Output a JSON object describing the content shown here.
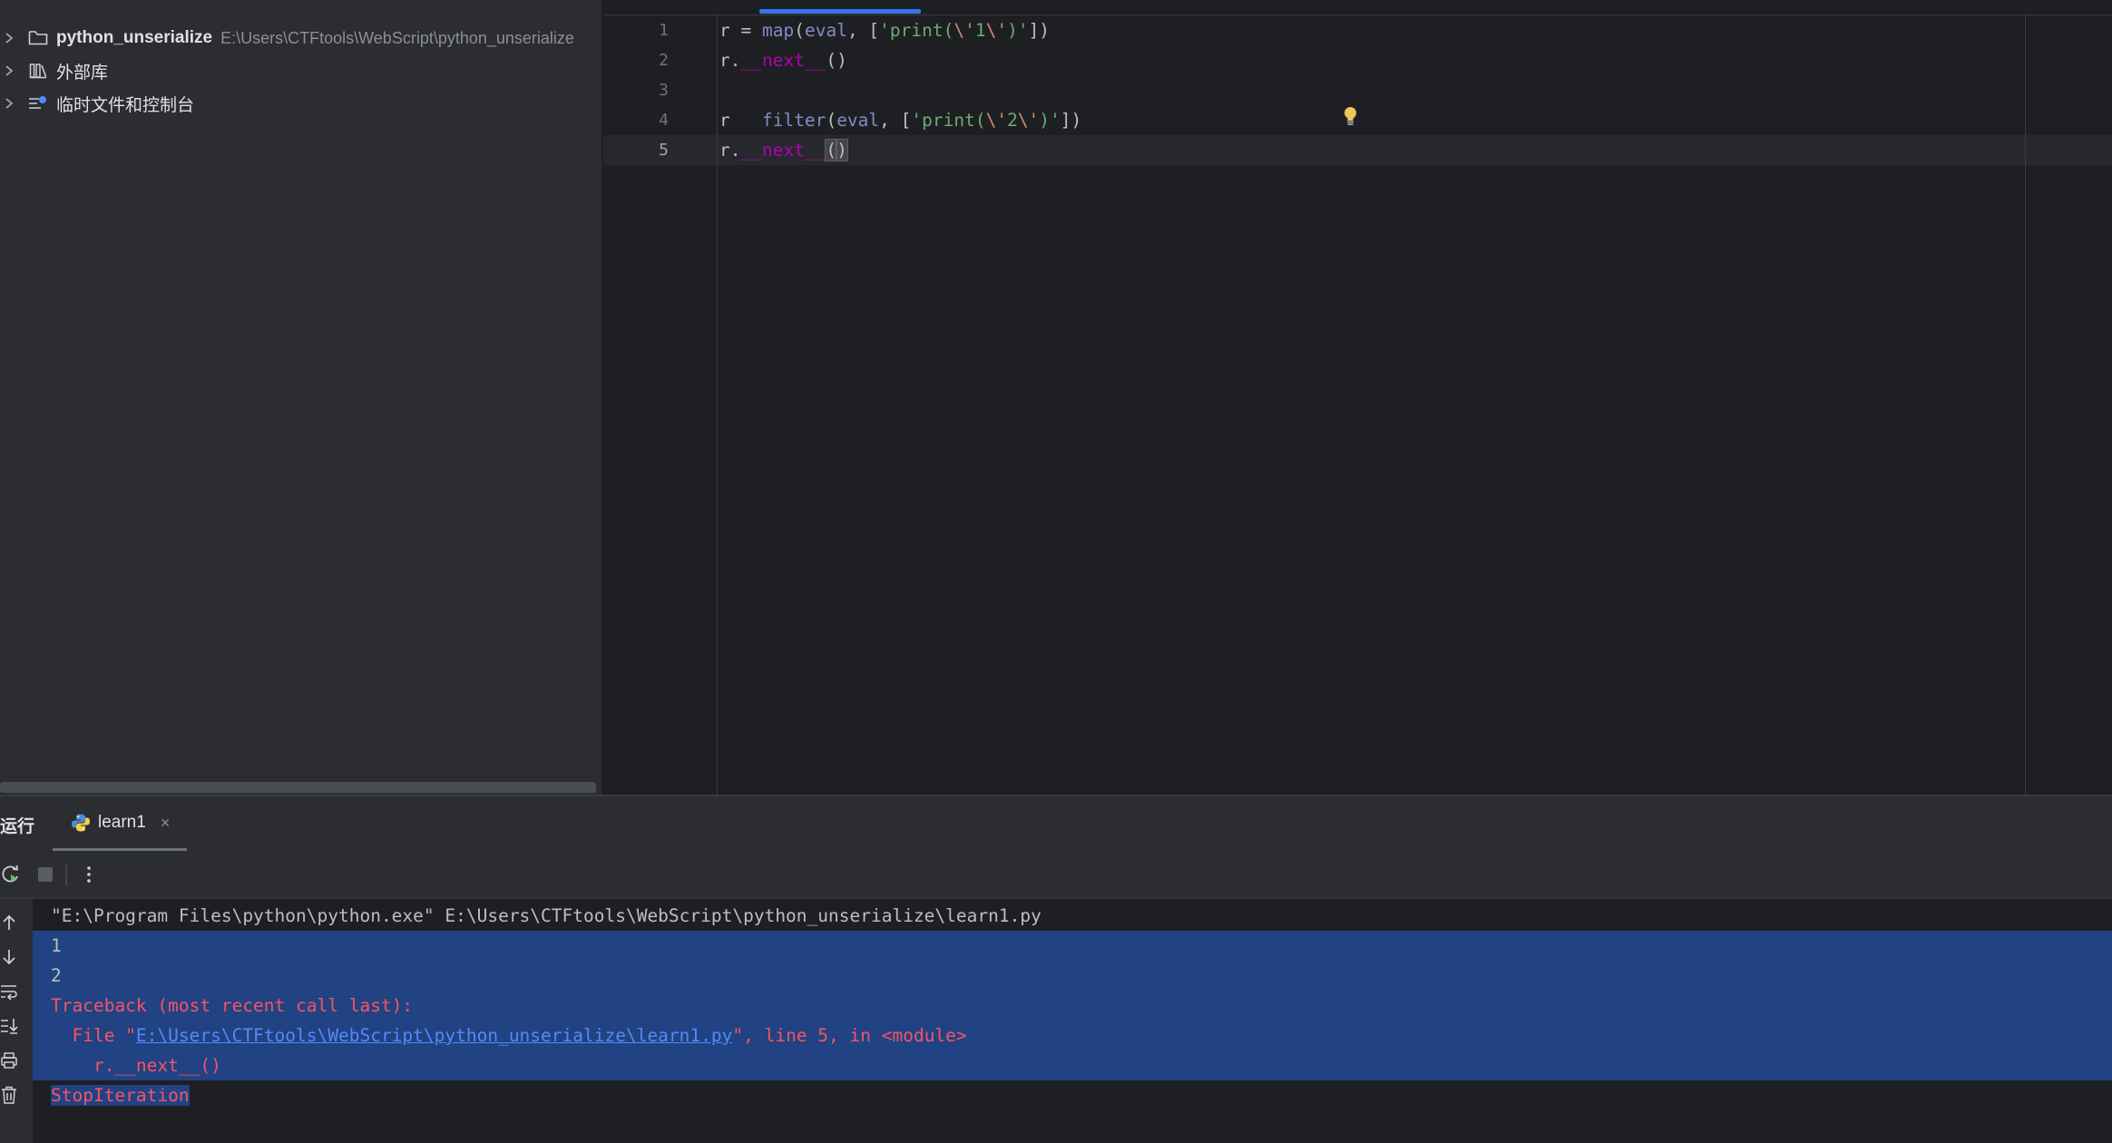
{
  "project_tree": [
    {
      "name": "python_unserialize",
      "path": "E:\\Users\\CTFtools\\WebScript\\python_unserialize",
      "icon": "folder-icon"
    },
    {
      "name": "外部库",
      "path": "",
      "icon": "library-icon"
    },
    {
      "name": "临时文件和控制台",
      "path": "",
      "icon": "scratches-icon"
    }
  ],
  "editor": {
    "line_numbers": [
      "1",
      "2",
      "3",
      "4",
      "5"
    ],
    "lines": [
      [
        {
          "t": "r ",
          "c": "plain"
        },
        {
          "t": "=",
          "c": "plain"
        },
        {
          "t": " ",
          "c": "plain"
        },
        {
          "t": "map",
          "c": "builtin"
        },
        {
          "t": "(",
          "c": "plain"
        },
        {
          "t": "eval",
          "c": "builtin"
        },
        {
          "t": ", [",
          "c": "plain"
        },
        {
          "t": "'print(",
          "c": "str"
        },
        {
          "t": "\\'",
          "c": "esc"
        },
        {
          "t": "1",
          "c": "str"
        },
        {
          "t": "\\'",
          "c": "esc"
        },
        {
          "t": ")'",
          "c": "str"
        },
        {
          "t": "])",
          "c": "plain"
        }
      ],
      [
        {
          "t": "r.",
          "c": "plain"
        },
        {
          "t": "__next__",
          "c": "dunder"
        },
        {
          "t": "()",
          "c": "plain"
        }
      ],
      [],
      [
        {
          "t": "r",
          "c": "plain"
        },
        {
          "t": "  ",
          "c": "plain"
        },
        {
          "t": " ",
          "c": "plain"
        },
        {
          "t": "filter",
          "c": "builtin"
        },
        {
          "t": "(",
          "c": "plain"
        },
        {
          "t": "eval",
          "c": "builtin"
        },
        {
          "t": ", [",
          "c": "plain"
        },
        {
          "t": "'print(",
          "c": "str"
        },
        {
          "t": "\\'",
          "c": "esc"
        },
        {
          "t": "2",
          "c": "str"
        },
        {
          "t": "\\'",
          "c": "esc"
        },
        {
          "t": ")'",
          "c": "str"
        },
        {
          "t": "])",
          "c": "plain"
        }
      ],
      [
        {
          "t": "r.",
          "c": "plain"
        },
        {
          "t": "__next__",
          "c": "dunder"
        },
        {
          "t": "(",
          "c": "paren"
        },
        {
          "t": ")",
          "c": "paren"
        }
      ]
    ]
  },
  "run_panel": {
    "title": "运行",
    "tab_label": "learn1",
    "tab_close": "×",
    "command": "\"E:\\Program Files\\python\\python.exe\" E:\\Users\\CTFtools\\WebScript\\python_unserialize\\learn1.py",
    "output_1": "1",
    "output_2": "2",
    "traceback_header": "Traceback (most recent call last):",
    "file_prefix": "  File \"",
    "file_link": "E:\\Users\\CTFtools\\WebScript\\python_unserialize\\learn1.py",
    "file_suffix": "\", line 5, in <module>",
    "code_line": "    r.__next__()",
    "error": "StopIteration"
  },
  "colors": {
    "accent": "#3574f0",
    "selection": "#214283",
    "error": "#f75464",
    "link": "#548af7"
  }
}
